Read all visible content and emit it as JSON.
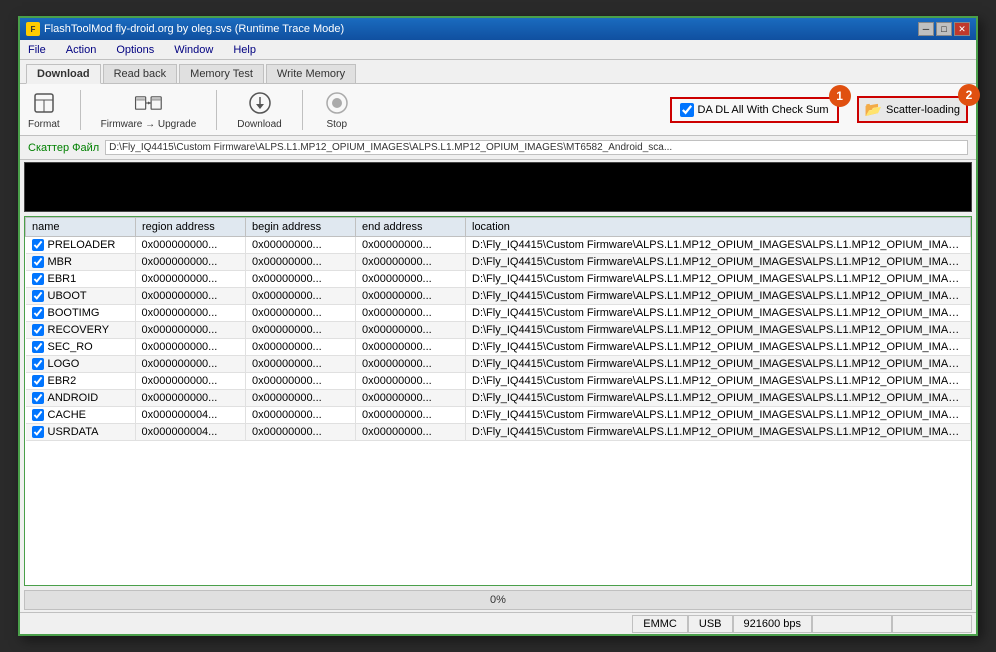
{
  "window": {
    "title": "FlashToolMod fly-droid.org by oleg.svs (Runtime Trace Mode)",
    "title_icon": "F",
    "btn_minimize": "─",
    "btn_restore": "□",
    "btn_close": "✕"
  },
  "menu": {
    "items": [
      "File",
      "Action",
      "Options",
      "Window",
      "Help"
    ]
  },
  "tabs": [
    {
      "label": "Download",
      "active": true
    },
    {
      "label": "Read back",
      "active": false
    },
    {
      "label": "Memory Test",
      "active": false
    },
    {
      "label": "Write Memory",
      "active": false
    }
  ],
  "toolbar": {
    "format_label": "Format",
    "firmware_label": "Firmware",
    "firmware_sub": "→ Upgrade",
    "download_label": "Download",
    "stop_label": "Stop"
  },
  "da_checkbox": {
    "label": "DA DL All With Check Sum",
    "checked": true
  },
  "scatter_btn": {
    "label": "Scatter-loading"
  },
  "scatter_file": {
    "label": "Скаттер Файл",
    "path": "D:\\Fly_IQ4415\\Custom Firmware\\ALPS.L1.MP12_OPIUM_IMAGES\\ALPS.L1.MP12_OPIUM_IMAGES\\MT6582_Android_sca..."
  },
  "table": {
    "headers": [
      "name",
      "region address",
      "begin address",
      "end address",
      "location"
    ],
    "rows": [
      {
        "checked": true,
        "name": "PRELOADER",
        "region": "0x000000000...",
        "begin": "0x00000000...",
        "end": "0x00000000...",
        "location": "D:\\Fly_IQ4415\\Custom Firmware\\ALPS.L1.MP12_OPIUM_IMAGES\\ALPS.L1.MP12_OPIUM_IMAG..."
      },
      {
        "checked": true,
        "name": "MBR",
        "region": "0x000000000...",
        "begin": "0x00000000...",
        "end": "0x00000000...",
        "location": "D:\\Fly_IQ4415\\Custom Firmware\\ALPS.L1.MP12_OPIUM_IMAGES\\ALPS.L1.MP12_OPIUM_IMAG..."
      },
      {
        "checked": true,
        "name": "EBR1",
        "region": "0x000000000...",
        "begin": "0x00000000...",
        "end": "0x00000000...",
        "location": "D:\\Fly_IQ4415\\Custom Firmware\\ALPS.L1.MP12_OPIUM_IMAGES\\ALPS.L1.MP12_OPIUM_IMAG..."
      },
      {
        "checked": true,
        "name": "UBOOT",
        "region": "0x000000000...",
        "begin": "0x00000000...",
        "end": "0x00000000...",
        "location": "D:\\Fly_IQ4415\\Custom Firmware\\ALPS.L1.MP12_OPIUM_IMAGES\\ALPS.L1.MP12_OPIUM_IMAG..."
      },
      {
        "checked": true,
        "name": "BOOTIMG",
        "region": "0x000000000...",
        "begin": "0x00000000...",
        "end": "0x00000000...",
        "location": "D:\\Fly_IQ4415\\Custom Firmware\\ALPS.L1.MP12_OPIUM_IMAGES\\ALPS.L1.MP12_OPIUM_IMAG..."
      },
      {
        "checked": true,
        "name": "RECOVERY",
        "region": "0x000000000...",
        "begin": "0x00000000...",
        "end": "0x00000000...",
        "location": "D:\\Fly_IQ4415\\Custom Firmware\\ALPS.L1.MP12_OPIUM_IMAGES\\ALPS.L1.MP12_OPIUM_IMAG..."
      },
      {
        "checked": true,
        "name": "SEC_RO",
        "region": "0x000000000...",
        "begin": "0x00000000...",
        "end": "0x00000000...",
        "location": "D:\\Fly_IQ4415\\Custom Firmware\\ALPS.L1.MP12_OPIUM_IMAGES\\ALPS.L1.MP12_OPIUM_IMAG..."
      },
      {
        "checked": true,
        "name": "LOGO",
        "region": "0x000000000...",
        "begin": "0x00000000...",
        "end": "0x00000000...",
        "location": "D:\\Fly_IQ4415\\Custom Firmware\\ALPS.L1.MP12_OPIUM_IMAGES\\ALPS.L1.MP12_OPIUM_IMAG..."
      },
      {
        "checked": true,
        "name": "EBR2",
        "region": "0x000000000...",
        "begin": "0x00000000...",
        "end": "0x00000000...",
        "location": "D:\\Fly_IQ4415\\Custom Firmware\\ALPS.L1.MP12_OPIUM_IMAGES\\ALPS.L1.MP12_OPIUM_IMAG..."
      },
      {
        "checked": true,
        "name": "ANDROID",
        "region": "0x000000000...",
        "begin": "0x00000000...",
        "end": "0x00000000...",
        "location": "D:\\Fly_IQ4415\\Custom Firmware\\ALPS.L1.MP12_OPIUM_IMAGES\\ALPS.L1.MP12_OPIUM_IMAG..."
      },
      {
        "checked": true,
        "name": "CACHE",
        "region": "0x000000004...",
        "begin": "0x00000000...",
        "end": "0x00000000...",
        "location": "D:\\Fly_IQ4415\\Custom Firmware\\ALPS.L1.MP12_OPIUM_IMAGES\\ALPS.L1.MP12_OPIUM_IMAG..."
      },
      {
        "checked": true,
        "name": "USRDATA",
        "region": "0x000000004...",
        "begin": "0x00000000...",
        "end": "0x00000000...",
        "location": "D:\\Fly_IQ4415\\Custom Firmware\\ALPS.L1.MP12_OPIUM_IMAGES\\ALPS.L1.MP12_OPIUM_IMAG..."
      }
    ]
  },
  "progress": {
    "value": "0%"
  },
  "status_bar": {
    "emmc": "EMMC",
    "usb": "USB",
    "baud": "921600 bps"
  },
  "annotations": {
    "bubble_1": "1",
    "bubble_2": "2"
  }
}
